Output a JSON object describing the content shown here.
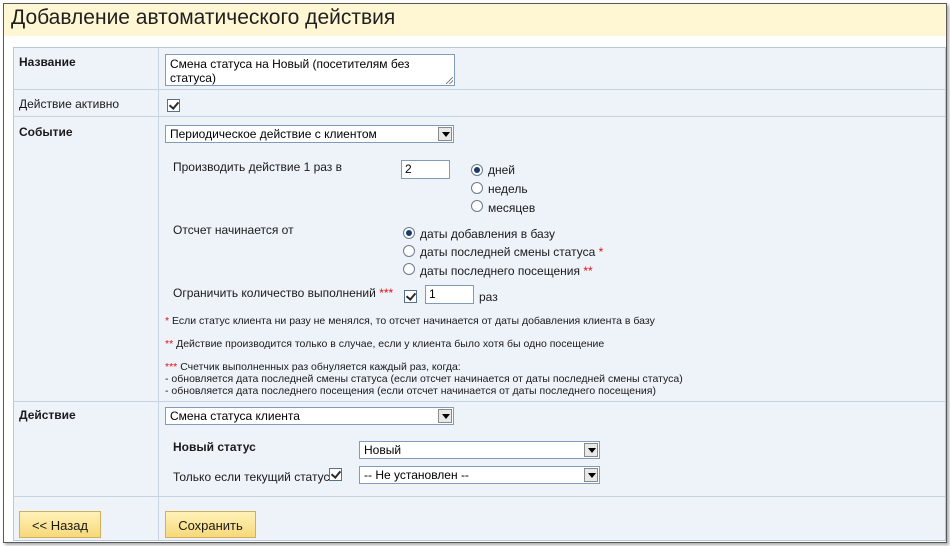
{
  "page": {
    "title": "Добавление автоматического действия"
  },
  "name_row": {
    "label": "Название",
    "value": "Смена статуса на Новый (посетителям без статуса)"
  },
  "active_row": {
    "label": "Действие активно",
    "checked": true
  },
  "event_row": {
    "label": "Событие",
    "event_select": "Периодическое действие с клиентом",
    "period_label": "Производить действие 1 раз в",
    "period_value": "2",
    "period_units": [
      {
        "label": "дней",
        "selected": true
      },
      {
        "label": "недель",
        "selected": false
      },
      {
        "label": "месяцев",
        "selected": false
      }
    ],
    "start_label": "Отсчет начинается от",
    "start_options": [
      {
        "label": "даты добавления в базу",
        "mark": "",
        "selected": true
      },
      {
        "label": "даты последней смены статуса",
        "mark": "*",
        "selected": false
      },
      {
        "label": "даты последнего посещения",
        "mark": "**",
        "selected": false
      }
    ],
    "limit_label": "Ограничить количество выполнений",
    "limit_mark": "***",
    "limit_checked": true,
    "limit_value": "1",
    "limit_unit": "раз",
    "note1_mark": "*",
    "note1_text": "Если статус клиента ни разу не менялся, то отсчет начинается от даты добавления клиента в базу",
    "note2_mark": "**",
    "note2_text": "Действие производится только в случае, если у клиента было хотя бы одно посещение",
    "note3_mark": "***",
    "note3_line1": "Счетчик выполненных раз обнуляется каждый раз, когда:",
    "note3_line2": "- обновляется дата последней смены статуса (если отсчет начинается от даты последней смены статуса)",
    "note3_line3": "- обновляется дата последнего посещения (если отсчет начинается от даты последнего посещения)"
  },
  "action_row": {
    "label": "Действие",
    "action_select": "Смена статуса клиента",
    "new_status_label": "Новый статус",
    "new_status_value": "Новый",
    "only_if_label": "Только если текущий статус",
    "only_if_checked": true,
    "current_status_value": "-- Не установлен --"
  },
  "buttons": {
    "back": "<< Назад",
    "save": "Сохранить"
  },
  "colors": {
    "header_bg": "#fff7d4",
    "table_bg": "#eef3fa",
    "button_bg": "#f7d97a",
    "required_mark": "#e01010"
  }
}
